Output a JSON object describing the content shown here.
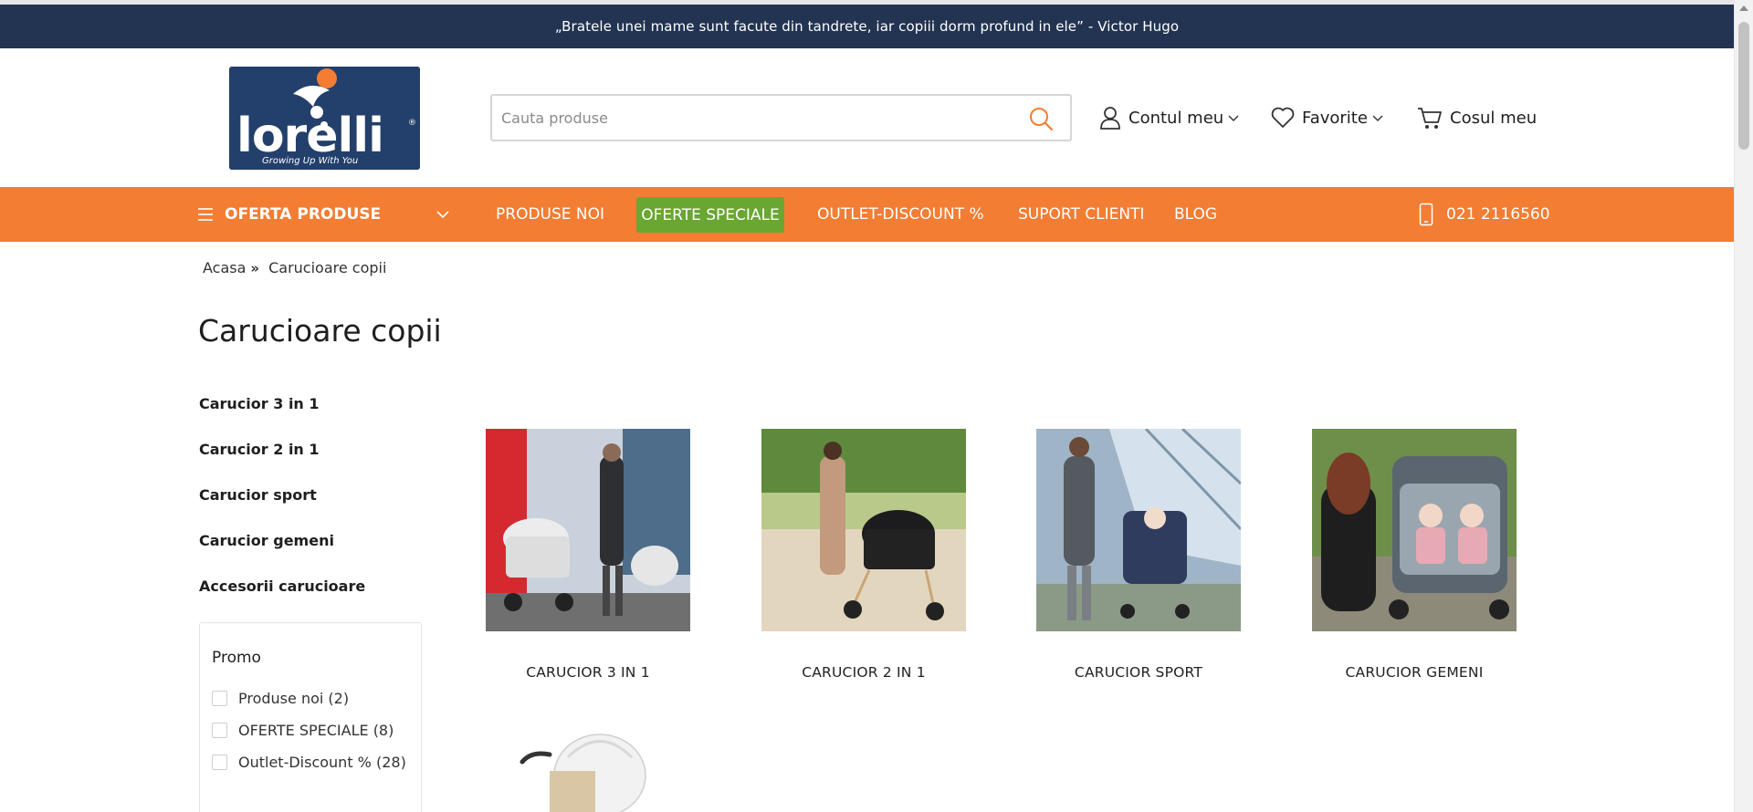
{
  "top_quote": "„Bratele unei mame sunt facute din tandrete, iar copiii dorm profund in ele” - Victor Hugo",
  "logo": {
    "text": "lorelli",
    "tagline": "Growing Up With You"
  },
  "search": {
    "placeholder": "Cauta produse"
  },
  "header_links": {
    "account": "Contul meu",
    "favorites": "Favorite",
    "cart": "Cosul meu"
  },
  "nav": {
    "offer_label": "OFERTA PRODUSE",
    "items": [
      "PRODUSE NOI",
      "OFERTE SPECIALE",
      "OUTLET-DISCOUNT %",
      "SUPORT CLIENTI",
      "BLOG"
    ],
    "phone": "021 2116560"
  },
  "breadcrumb": {
    "home": "Acasa",
    "sep": "»",
    "current": "Carucioare copii"
  },
  "page_title": "Carucioare copii",
  "categories": [
    "Carucior 3 in 1",
    "Carucior 2 in 1",
    "Carucior sport",
    "Carucior gemeni",
    "Accesorii carucioare"
  ],
  "promo": {
    "title": "Promo",
    "options": [
      "Produse noi (2)",
      "OFERTE SPECIALE (8)",
      "Outlet-Discount % (28)"
    ]
  },
  "products": [
    {
      "caption": "CARUCIOR 3 IN 1"
    },
    {
      "caption": "CARUCIOR 2 IN 1"
    },
    {
      "caption": "CARUCIOR SPORT"
    },
    {
      "caption": "CARUCIOR GEMENI"
    }
  ],
  "colors": {
    "navy": "#233452",
    "orange": "#f27d33",
    "green": "#6aa632"
  }
}
